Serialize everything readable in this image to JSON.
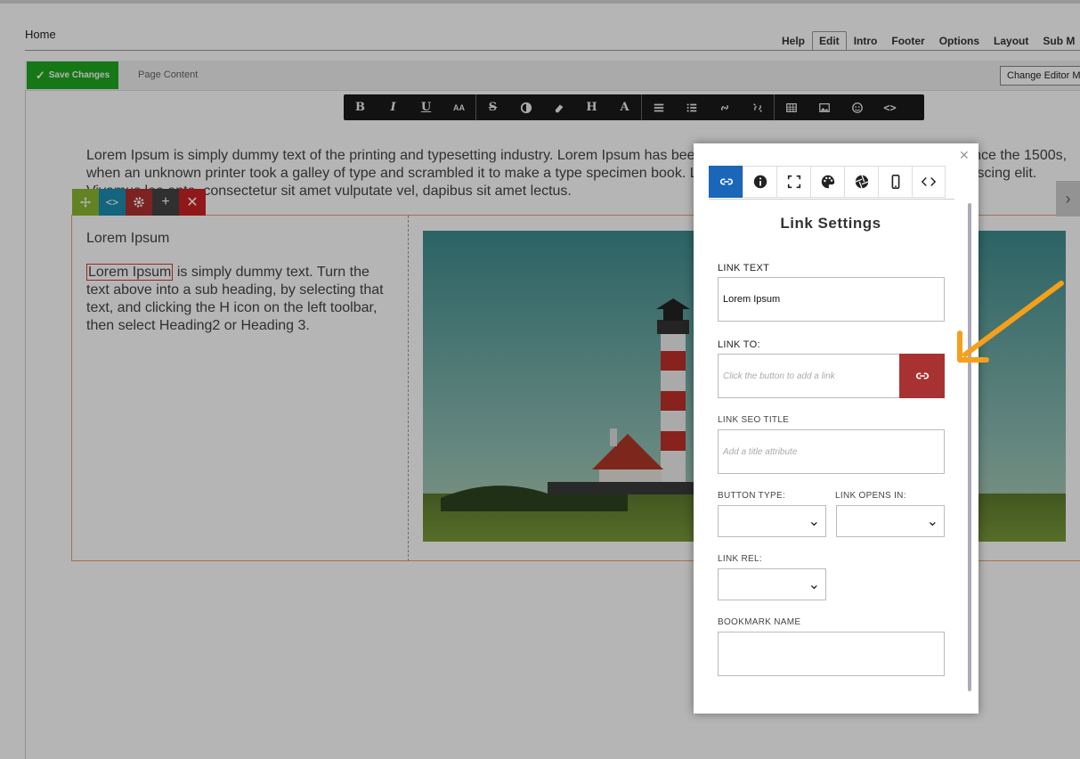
{
  "header": {
    "home": "Home",
    "nav": [
      {
        "label": "Help",
        "active": false
      },
      {
        "label": "Edit",
        "active": true
      },
      {
        "label": "Intro",
        "active": false
      },
      {
        "label": "Footer",
        "active": false
      },
      {
        "label": "Options",
        "active": false
      },
      {
        "label": "Layout",
        "active": false
      },
      {
        "label": "Sub M",
        "active": false
      }
    ]
  },
  "editbar": {
    "save_label": "Save Changes",
    "page_content_label": "Page Content",
    "change_editor_label": "Change Editor M"
  },
  "toolbar": {
    "items": [
      "bold",
      "italic",
      "underline",
      "font-size",
      "strikethrough",
      "contrast",
      "eraser",
      "heading",
      "font-color",
      "align",
      "list",
      "link",
      "unlink",
      "table",
      "image",
      "emoji",
      "code"
    ]
  },
  "content": {
    "paragraph": "Lorem Ipsum is simply dummy text of the printing and typesetting industry. Lorem Ipsum has been the industry's standard dummy text ever since the 1500s, when an unknown printer took a galley of type and scrambled it to make a type specimen book. Lorem ipsum dolor sit amet, consectetur adipiscing elit. Vivamus leo ante, consectetur sit amet vulputate vel, dapibus sit amet lectus.",
    "sub_heading": "Lorem Ipsum",
    "selected_text": "Lorem Ipsum",
    "col_text_rest": " is simply dummy text. Turn the text above into a sub heading, by selecting that text, and clicking the H icon on the left toolbar, then select Heading2 or Heading 3.",
    "image_alt": "lighthouse photo"
  },
  "row_controls": [
    {
      "name": "move",
      "color": "#8bb832"
    },
    {
      "name": "code",
      "color": "#1a8fb0"
    },
    {
      "name": "settings",
      "color": "#b03030"
    },
    {
      "name": "add",
      "color": "#444444"
    },
    {
      "name": "delete",
      "color": "#cc2222"
    }
  ],
  "modal": {
    "title": "Link Settings",
    "tabs": [
      "link-icon",
      "info-icon",
      "expand-icon",
      "palette-icon",
      "aperture-icon",
      "mobile-icon",
      "code-icon"
    ],
    "link_text_label": "LINK TEXT",
    "link_text_value": "Lorem Ipsum",
    "link_to_label": "LINK TO:",
    "link_to_placeholder": "Click the button to add a link",
    "seo_title_label": "LINK SEO TITLE",
    "seo_title_placeholder": "Add a title attribute",
    "button_type_label": "BUTTON TYPE:",
    "link_opens_label": "LINK OPENS IN:",
    "link_rel_label": "LINK REL:",
    "bookmark_label": "BOOKMARK NAME"
  },
  "colors": {
    "accent": "#1a66b8",
    "save": "#1ea81e",
    "link_button": "#a83232",
    "arrow": "#f5a01a"
  }
}
